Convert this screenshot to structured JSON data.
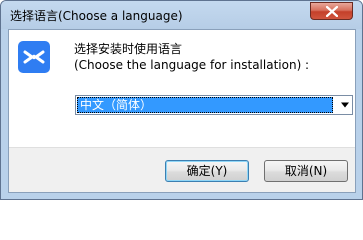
{
  "window": {
    "title": "选择语言(Choose a language)"
  },
  "dialog": {
    "prompt_line1": "选择安装时使用语言",
    "prompt_line2": "(Choose the language for installation) :",
    "language_select": {
      "selected": "中文（简体）"
    }
  },
  "buttons": {
    "ok_label": "确定(Y)",
    "cancel_label": "取消(N)"
  },
  "icons": {
    "app": "app-logo-icon",
    "close": "close-icon",
    "dropdown": "chevron-down-icon"
  },
  "colors": {
    "app_icon_bg": "#2f7df2",
    "close_button": "#c4402a",
    "selection_highlight": "#3399ff",
    "titlebar": "#b9d1ea"
  }
}
